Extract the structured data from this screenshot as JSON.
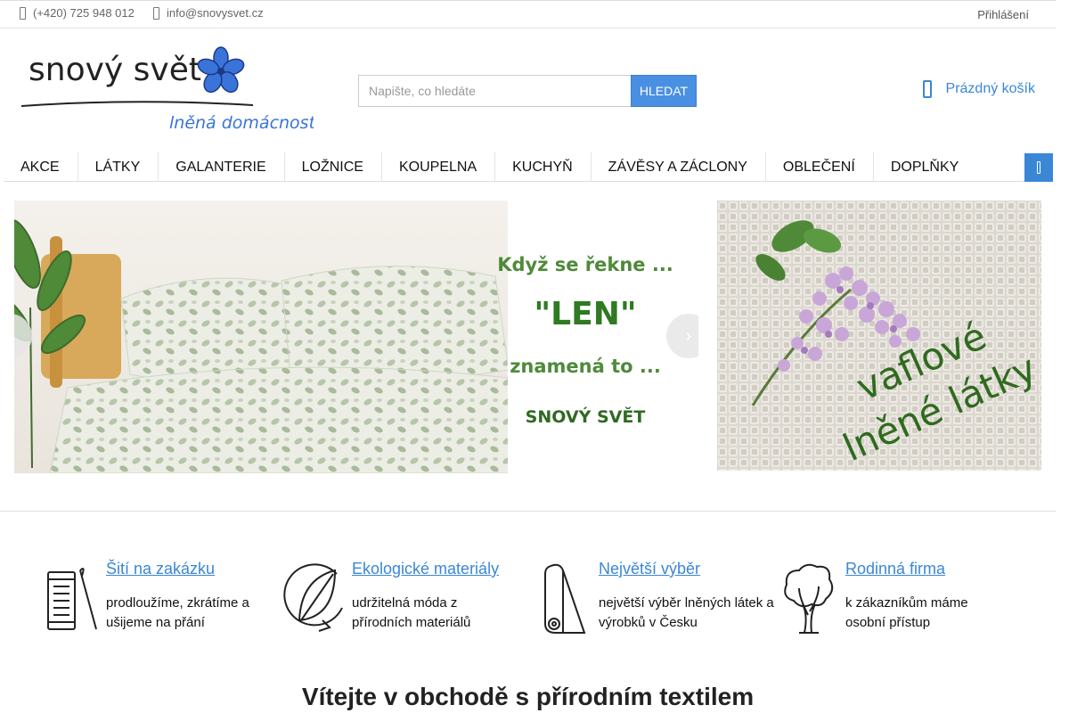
{
  "topbar": {
    "phone": "(+420) 725 948 012",
    "email": "info@snovysvet.cz",
    "login": "Přihlášení"
  },
  "logo": {
    "wordmark": "snový svět",
    "tagline": "lněná domácnost"
  },
  "search": {
    "placeholder": "Napište, co hledáte",
    "button_label": "HLEDAT"
  },
  "cart": {
    "label": "Prázdný košík"
  },
  "nav": {
    "items": [
      "AKCE",
      "LÁTKY",
      "GALANTERIE",
      "LOŽNICE",
      "KOUPELNA",
      "KUCHYŇ",
      "ZÁVĚSY A ZÁCLONY",
      "OBLEČENÍ",
      "DOPLŇKY"
    ]
  },
  "banners": {
    "left": {
      "line1": "Když se řekne ...",
      "line2": "\"LEN\"",
      "line3": "znamená to ...",
      "line4": "SNOVÝ SVĚT"
    },
    "right": {
      "line1": "vaflové",
      "line2": "lněné látky"
    }
  },
  "features": [
    {
      "title": "Šití na zakázku",
      "desc": "prodloužíme, zkrátíme a ušijeme na přání",
      "icon": "sewing-spool-icon"
    },
    {
      "title": "Ekologické materiály",
      "desc": "udržitelná móda z přírodních materiálů",
      "icon": "leaf-icon"
    },
    {
      "title": "Největší výběr",
      "desc": "největší výběr lněných látek a výrobků v Česku",
      "icon": "fabric-roll-icon"
    },
    {
      "title": "Rodinná firma",
      "desc": "k zákazníkům máme osobní přístup",
      "icon": "tree-icon"
    }
  ],
  "welcome_heading": "Vítejte v obchodě s přírodním textilem",
  "colors": {
    "accent": "#3a87d6",
    "search_button": "#4a90e2",
    "banner_text_green": "#4f8a3a"
  }
}
